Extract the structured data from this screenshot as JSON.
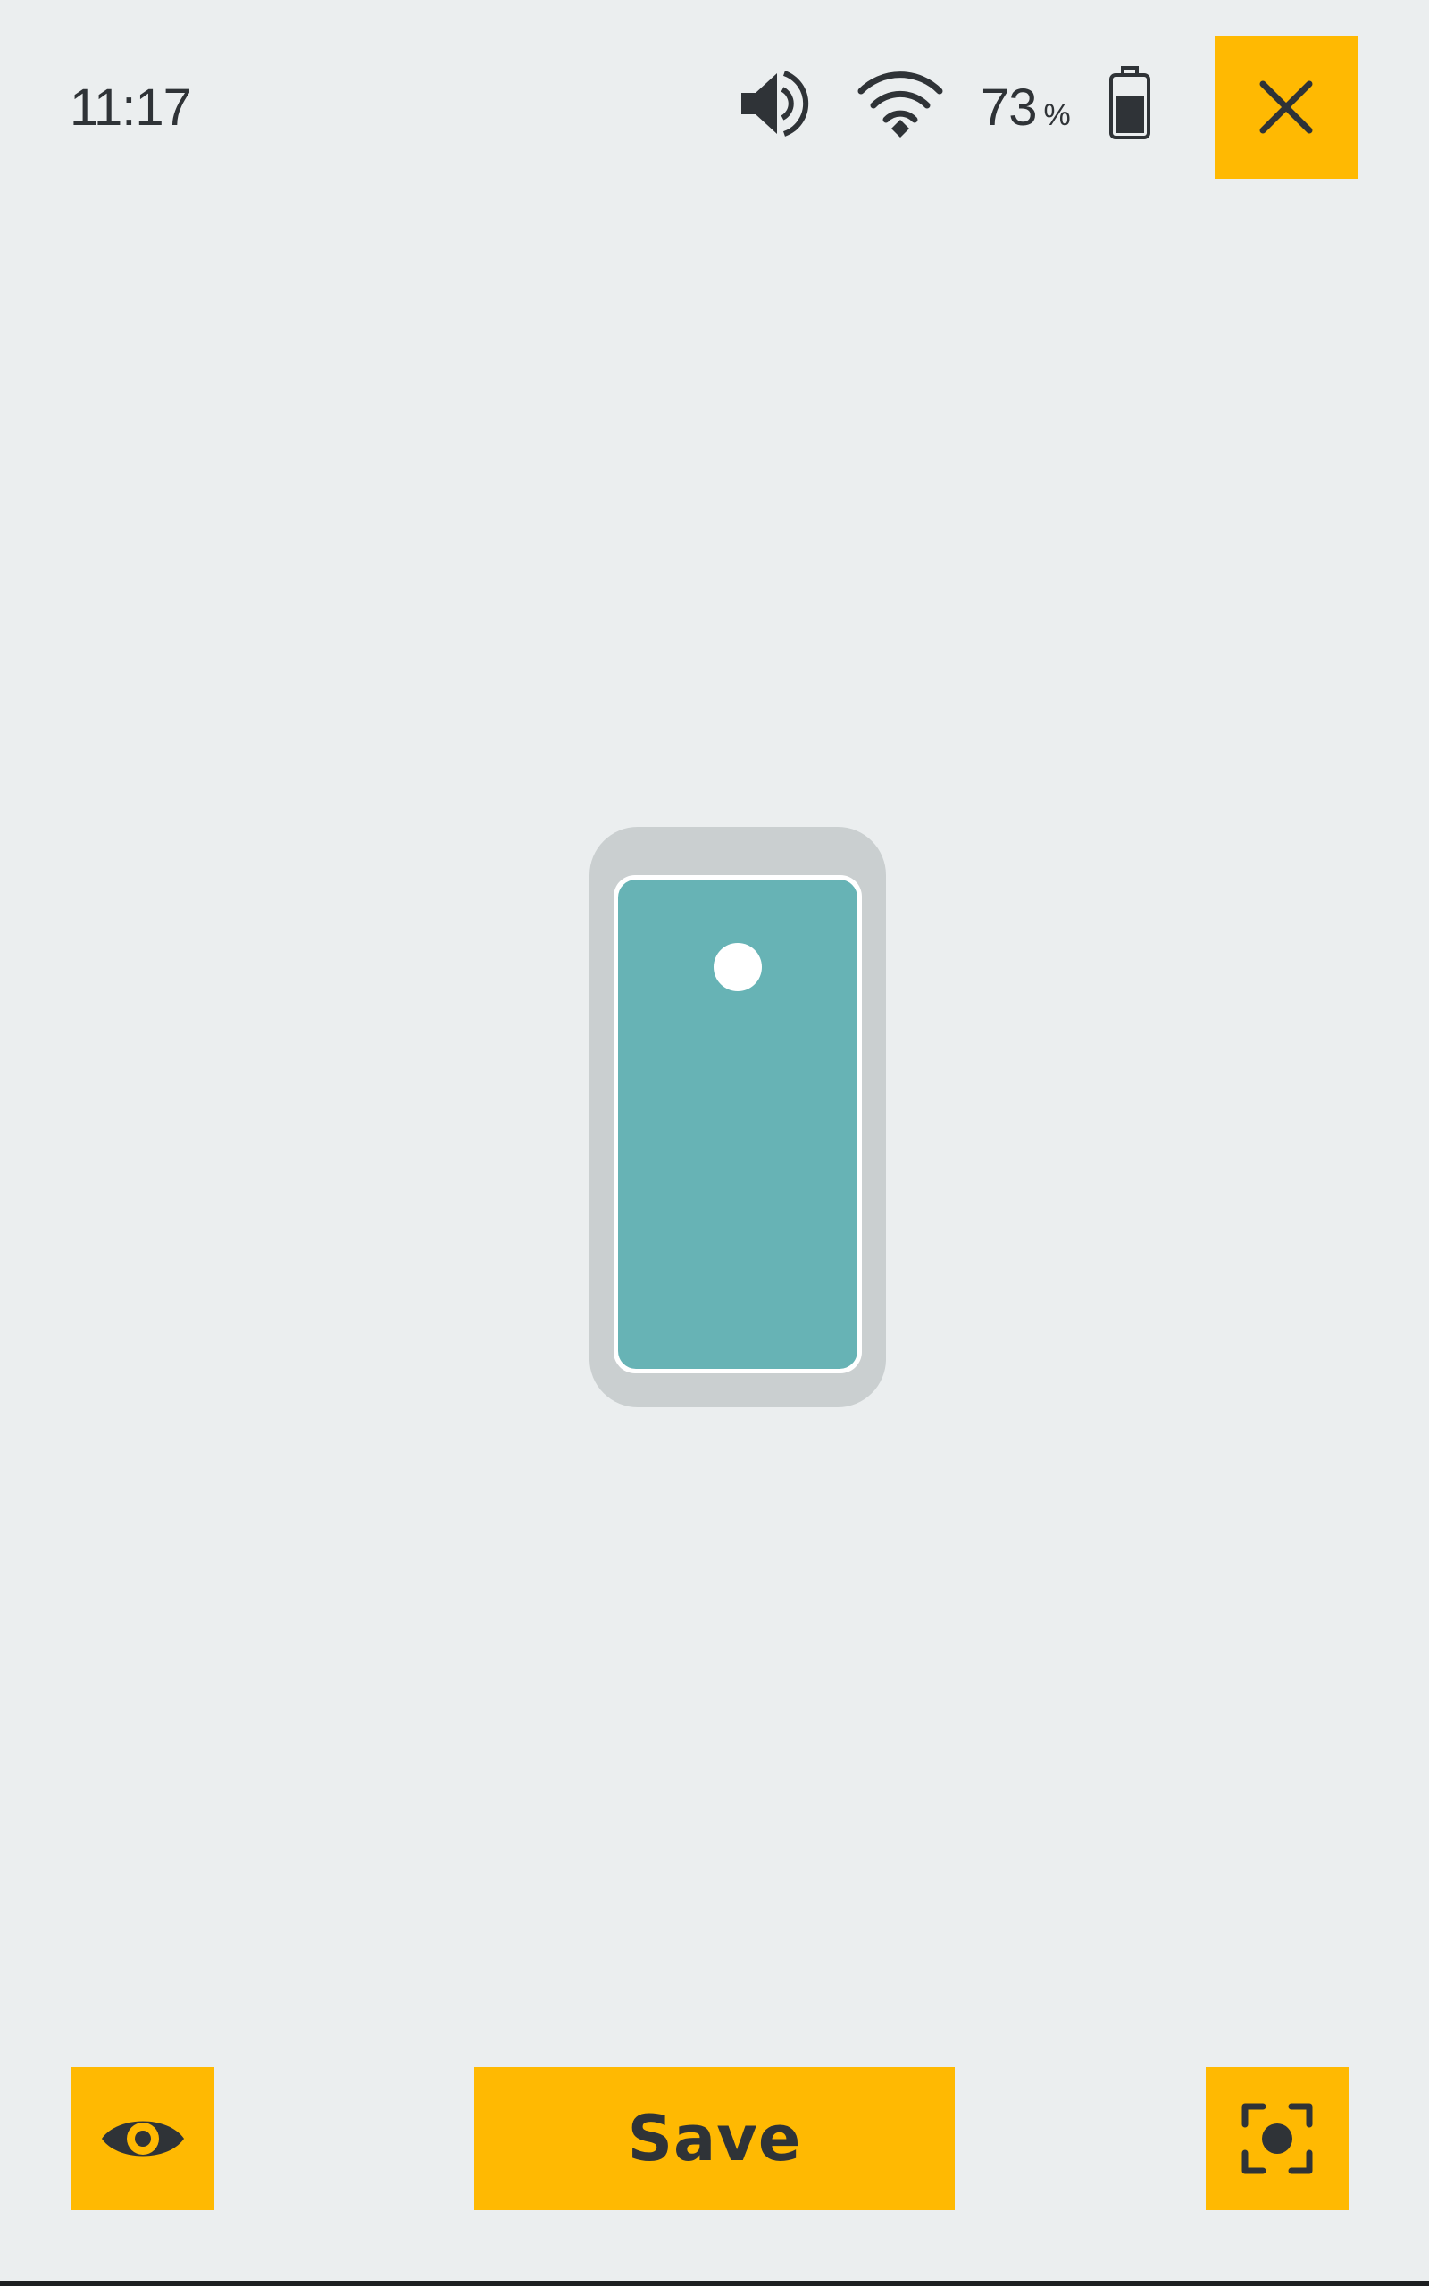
{
  "status_bar": {
    "time": "11:17",
    "battery_percent": "73",
    "battery_percent_sign": "%",
    "icons": [
      "volume-icon",
      "wifi-icon",
      "battery-icon"
    ]
  },
  "header": {
    "close_icon": "close-icon"
  },
  "preview": {
    "illustration": "phone-illustration",
    "screen_color": "#67b3b5",
    "frame_color": "#cacfd0"
  },
  "toolbar": {
    "eye_icon": "eye-icon",
    "save_label": "Save",
    "focus_icon": "focus-icon"
  },
  "colors": {
    "accent": "#ffb902",
    "background": "#ebeeef",
    "foreground": "#2f3337"
  }
}
